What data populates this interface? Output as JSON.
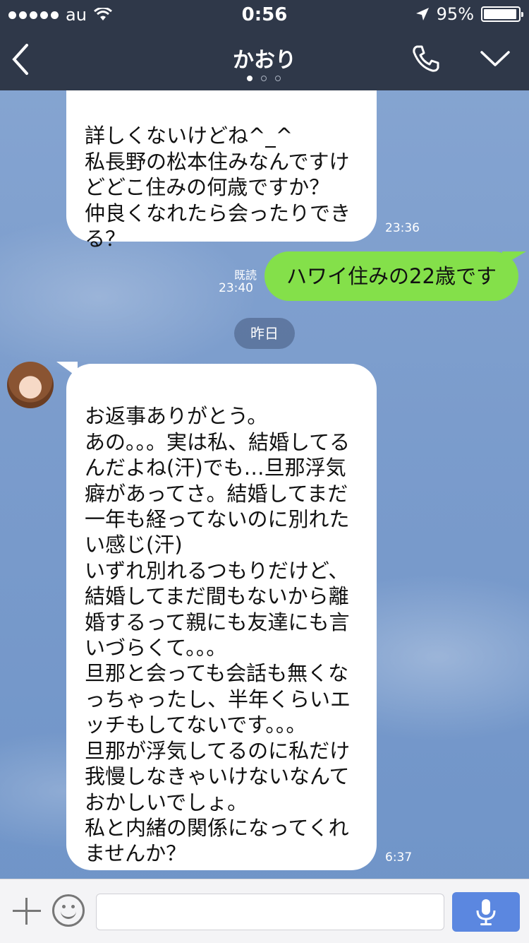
{
  "status_bar": {
    "carrier": "au",
    "time": "0:56",
    "battery": "95%"
  },
  "header": {
    "title": "かおり",
    "page_count": 3,
    "current_page": 1
  },
  "messages": [
    {
      "side": "left",
      "text": "詳しくないけどね^_^\n私長野の松本住みなんですけどどこ住みの何歳ですか？\n仲良くなれたら会ったりできる？",
      "time": "23:36"
    },
    {
      "side": "right",
      "text": "ハワイ住みの22歳です",
      "read": "既読",
      "time": "23:40"
    },
    {
      "date_separator": "昨日"
    },
    {
      "side": "left",
      "text": "お返事ありがとう。\nあの。。。実は私、結婚してるんだよね(汗)でも…旦那浮気癖があってさ。結婚してまだ一年も経ってないのに別れたい感じ(汗)\nいずれ別れるつもりだけど、結婚してまだ間もないから離婚するって親にも友達にも言いづらくて。。。\n旦那と会っても会話も無くなっちゃったし、半年くらいエッチもしてないです。。。\n旦那が浮気してるのに私だけ我慢しなきゃいけないなんておかしいでしょ。\n私と内緒の関係になってくれませんか？",
      "time": "6:37"
    }
  ],
  "colors": {
    "header_bg": "#2f3849",
    "sent_bubble": "#84e04a",
    "received_bubble": "#ffffff",
    "send_button": "#5b87e0"
  },
  "icons": [
    "back-icon",
    "phone-icon",
    "chevron-down-icon",
    "plus-icon",
    "emoji-icon",
    "microphone-icon",
    "wifi-icon",
    "location-arrow-icon",
    "battery-icon"
  ]
}
